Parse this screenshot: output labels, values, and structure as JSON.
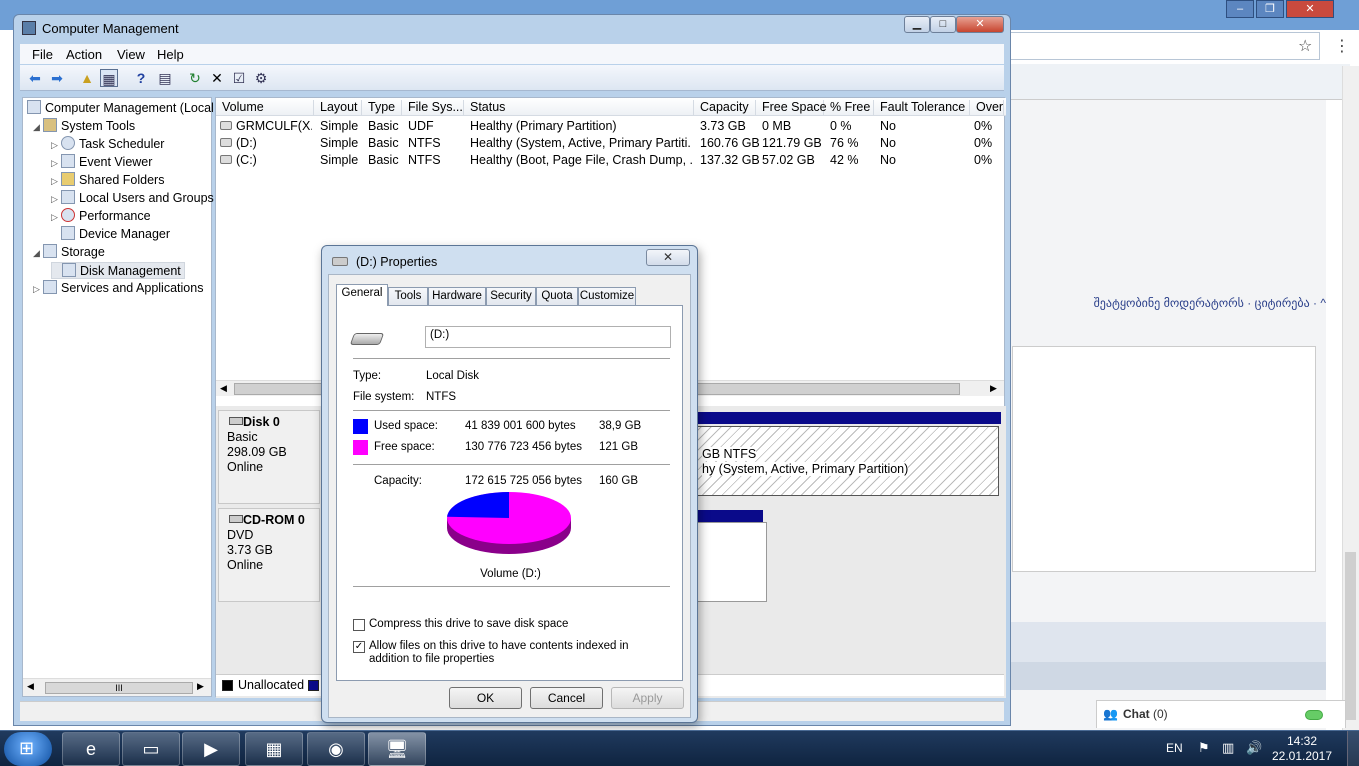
{
  "browser": {
    "georgian_text": "შეატყობინე მოდერატორს  · ციტირება · ^",
    "chat_label": "Chat",
    "chat_count": "(0)"
  },
  "window": {
    "title": "Computer Management",
    "menu": [
      "File",
      "Action",
      "View",
      "Help"
    ]
  },
  "tree": {
    "items": [
      {
        "label": "Computer Management (Local",
        "expander": ""
      },
      {
        "label": "System Tools",
        "expander": "◢"
      },
      {
        "label": "Task Scheduler",
        "expander": "▷"
      },
      {
        "label": "Event Viewer",
        "expander": "▷"
      },
      {
        "label": "Shared Folders",
        "expander": "▷"
      },
      {
        "label": "Local Users and Groups",
        "expander": "▷"
      },
      {
        "label": "Performance",
        "expander": "▷"
      },
      {
        "label": "Device Manager",
        "expander": ""
      },
      {
        "label": "Storage",
        "expander": "◢"
      },
      {
        "label": "Disk Management",
        "expander": ""
      },
      {
        "label": "Services and Applications",
        "expander": "▷"
      }
    ],
    "scroll_label": "III"
  },
  "volumes": {
    "columns": [
      "Volume",
      "Layout",
      "Type",
      "File Sys...",
      "Status",
      "Capacity",
      "Free Space",
      "% Free",
      "Fault Tolerance",
      "Overh"
    ],
    "rows": [
      [
        "GRMCULF(X...",
        "Simple",
        "Basic",
        "UDF",
        "Healthy (Primary Partition)",
        "3.73 GB",
        "0 MB",
        "0 %",
        "No",
        "0%"
      ],
      [
        "(D:)",
        "Simple",
        "Basic",
        "NTFS",
        "Healthy (System, Active, Primary Partiti...",
        "160.76 GB",
        "121.79 GB",
        "76 %",
        "No",
        "0%"
      ],
      [
        "(C:)",
        "Simple",
        "Basic",
        "NTFS",
        "Healthy (Boot, Page File, Crash Dump, ...",
        "137.32 GB",
        "57.02 GB",
        "42 %",
        "No",
        "0%"
      ]
    ]
  },
  "disks": [
    {
      "name": "Disk 0",
      "type": "Basic",
      "size": "298.09 GB",
      "state": "Online",
      "part_line1": "GB NTFS",
      "part_line2": "hy (System, Active, Primary Partition)"
    },
    {
      "name": "CD-ROM 0",
      "type": "DVD",
      "size": "3.73 GB",
      "state": "Online"
    }
  ],
  "legend": {
    "unallocated": "Unallocated"
  },
  "dialog": {
    "title": "(D:) Properties",
    "tabs": [
      "General",
      "Tools",
      "Hardware",
      "Security",
      "Quota",
      "Customize"
    ],
    "drive_name": "(D:)",
    "type_label": "Type:",
    "type_value": "Local Disk",
    "fs_label": "File system:",
    "fs_value": "NTFS",
    "used_label": "Used space:",
    "used_bytes": "41 839 001 600 bytes",
    "used_gb": "38,9 GB",
    "free_label": "Free space:",
    "free_bytes": "130 776 723 456 bytes",
    "free_gb": "121 GB",
    "capacity_label": "Capacity:",
    "capacity_bytes": "172 615 725 056 bytes",
    "capacity_gb": "160 GB",
    "pie_caption": "Volume  (D:)",
    "used_fraction": 0.2424,
    "used_color": "#0000ff",
    "free_color": "#ff00ff",
    "compress_label": "Compress this drive to save disk space",
    "compress_checked": false,
    "index_label": "Allow files on this drive to have contents indexed in addition to file properties",
    "index_checked": true,
    "ok": "OK",
    "cancel": "Cancel",
    "apply": "Apply"
  },
  "taskbar": {
    "lang": "EN",
    "time": "14:32",
    "date": "22.01.2017"
  }
}
